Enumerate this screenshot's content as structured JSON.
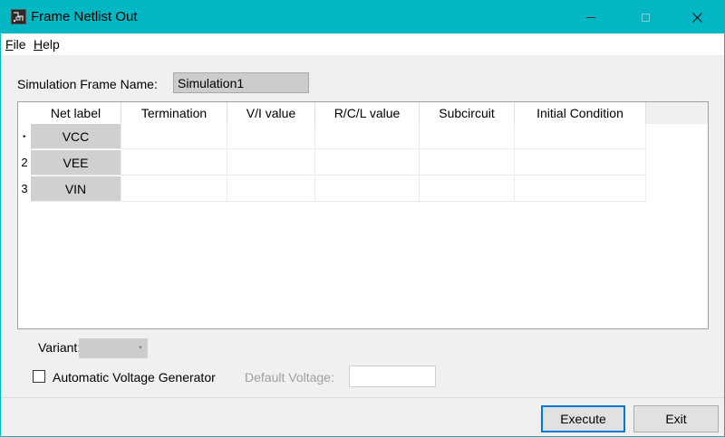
{
  "window": {
    "title": "Frame Netlist Out"
  },
  "menu": {
    "file": {
      "key": "F",
      "rest": "ile"
    },
    "help": {
      "key": "H",
      "rest": "elp"
    }
  },
  "form": {
    "frame_name_label": "Simulation Frame Name:",
    "frame_name_value": "Simulation1",
    "variant_label": "Variant:",
    "avg_label": "Automatic Voltage Generator",
    "default_voltage_label": "Default Voltage:"
  },
  "grid": {
    "columns": [
      "Net label",
      "Termination",
      "V/I value",
      "R/C/L value",
      "Subcircuit",
      "Initial Condition"
    ],
    "rows": [
      {
        "marker": "‣",
        "net_label": "VCC"
      },
      {
        "marker": "2",
        "net_label": "VEE"
      },
      {
        "marker": "3",
        "net_label": "VIN"
      }
    ]
  },
  "buttons": {
    "execute": "Execute",
    "exit": "Exit"
  },
  "colors": {
    "titlebar": "#00b7c3",
    "focus": "#0078d7"
  }
}
